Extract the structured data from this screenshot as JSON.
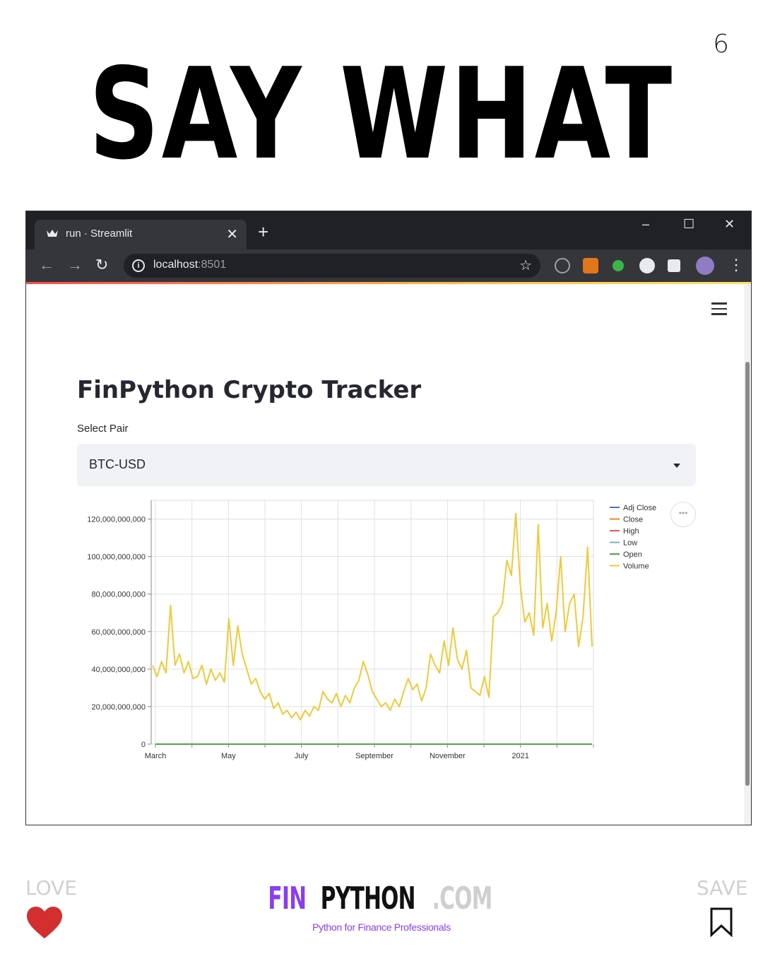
{
  "page": {
    "number": "6",
    "headline": "SAY WHAT"
  },
  "browser": {
    "tab_title": "run · Streamlit",
    "url_host": "localhost",
    "url_port": ":8501",
    "controls": {
      "minimize": "–",
      "maximize": "☐",
      "close": "✕"
    }
  },
  "app": {
    "title": "FinPython Crypto Tracker",
    "select_label": "Select Pair",
    "selected_pair": "BTC-USD"
  },
  "chart_data": {
    "type": "line",
    "title": "",
    "xlabel": "",
    "ylabel": "",
    "x_ticks": [
      "March",
      "May",
      "July",
      "September",
      "November",
      "2021"
    ],
    "y_ticks": [
      "0",
      "20,000,000,000",
      "40,000,000,000",
      "60,000,000,000",
      "80,000,000,000",
      "100,000,000,000",
      "120,000,000,000"
    ],
    "ylim": [
      0,
      130000000000
    ],
    "grid": true,
    "legend_position": "right",
    "series": [
      {
        "name": "Adj Close",
        "color": "#4c78a8",
        "values": [
          9100,
          9800,
          8900,
          6000,
          6500,
          7200,
          8800,
          9700,
          9500,
          9400,
          11300,
          11800,
          10800,
          13500,
          15600,
          19000,
          23000,
          33000,
          45000,
          49000
        ]
      },
      {
        "name": "Close",
        "color": "#f58518",
        "values": [
          9100,
          9800,
          8900,
          6000,
          6500,
          7200,
          8800,
          9700,
          9500,
          9400,
          11300,
          11800,
          10800,
          13500,
          15600,
          19000,
          23000,
          33000,
          45000,
          49000
        ]
      },
      {
        "name": "High",
        "color": "#e45756",
        "values": [
          9200,
          9900,
          9100,
          6200,
          6700,
          7400,
          9000,
          9900,
          9700,
          9600,
          11500,
          12000,
          11000,
          13800,
          16000,
          19400,
          23500,
          34000,
          46000,
          50000
        ]
      },
      {
        "name": "Low",
        "color": "#72b7b2",
        "values": [
          8900,
          9600,
          8700,
          5800,
          6300,
          7000,
          8600,
          9500,
          9300,
          9200,
          11100,
          11600,
          10600,
          13200,
          15300,
          18600,
          22500,
          32000,
          44000,
          48000
        ]
      },
      {
        "name": "Open",
        "color": "#54a24b",
        "values": [
          9000,
          9700,
          8800,
          5900,
          6400,
          7100,
          8700,
          9600,
          9400,
          9300,
          11200,
          11700,
          10700,
          13400,
          15500,
          18800,
          22800,
          32500,
          44500,
          48500
        ]
      },
      {
        "name": "Volume",
        "color": "#eeca3b",
        "values": [
          42,
          36,
          44,
          38,
          74,
          42,
          48,
          38,
          44,
          35,
          36,
          42,
          32,
          40,
          34,
          38,
          33,
          67,
          42,
          63,
          48,
          40,
          32,
          35,
          28,
          24,
          27,
          19,
          22,
          16,
          18,
          14,
          17,
          13,
          18,
          15,
          20,
          18,
          28,
          24,
          22,
          27,
          20,
          26,
          22,
          30,
          34,
          44,
          37,
          28,
          24,
          20,
          22,
          18,
          24,
          20,
          28,
          35,
          29,
          32,
          23,
          30,
          48,
          42,
          38,
          55,
          42,
          62,
          45,
          40,
          50,
          30,
          28,
          26,
          36,
          25,
          68,
          70,
          75,
          98,
          90,
          123,
          85,
          65,
          70,
          58,
          117,
          62,
          75,
          55,
          70,
          100,
          60,
          75,
          80,
          52,
          68,
          105,
          52
        ]
      }
    ]
  },
  "footer": {
    "love_label": "LOVE",
    "save_label": "SAVE",
    "brand_fin": "FIN",
    "brand_python": "PYTHON",
    "brand_com": ".COM",
    "tagline": "Python for Finance Professionals"
  }
}
